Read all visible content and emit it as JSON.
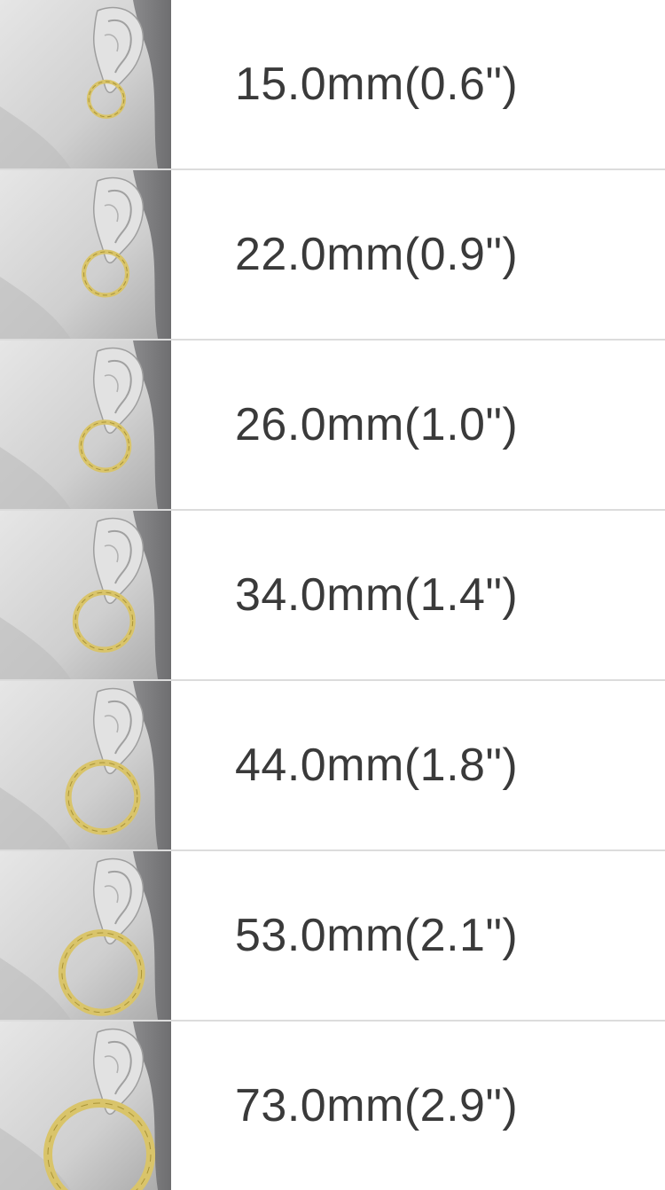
{
  "colors": {
    "text": "#3a3a3a",
    "divider": "#dcdcdc",
    "hoop_gold": "#d9c46a",
    "hoop_gold_dark": "#a89338",
    "skin_light": "#e6e6e6",
    "skin_shadow": "#a8a8a8",
    "hair": "#6e6e70"
  },
  "sizes": [
    {
      "label": "15.0mm(0.6\")",
      "diameter_mm": 15.0,
      "diameter_in": 0.6,
      "icon": "ear-hoop-thumbnail"
    },
    {
      "label": "22.0mm(0.9\")",
      "diameter_mm": 22.0,
      "diameter_in": 0.9,
      "icon": "ear-hoop-thumbnail"
    },
    {
      "label": "26.0mm(1.0\")",
      "diameter_mm": 26.0,
      "diameter_in": 1.0,
      "icon": "ear-hoop-thumbnail"
    },
    {
      "label": "34.0mm(1.4\")",
      "diameter_mm": 34.0,
      "diameter_in": 1.4,
      "icon": "ear-hoop-thumbnail"
    },
    {
      "label": "44.0mm(1.8\")",
      "diameter_mm": 44.0,
      "diameter_in": 1.8,
      "icon": "ear-hoop-thumbnail"
    },
    {
      "label": "53.0mm(2.1\")",
      "diameter_mm": 53.0,
      "diameter_in": 2.1,
      "icon": "ear-hoop-thumbnail"
    },
    {
      "label": "73.0mm(2.9\")",
      "diameter_mm": 73.0,
      "diameter_in": 2.9,
      "icon": "ear-hoop-thumbnail"
    }
  ]
}
